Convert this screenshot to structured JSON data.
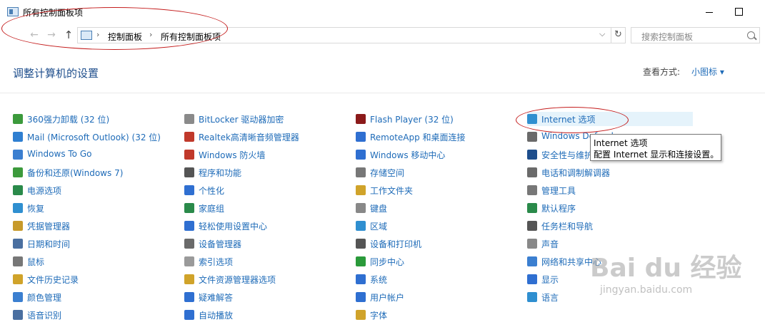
{
  "window": {
    "title": "所有控制面板项"
  },
  "nav": {
    "back": "←",
    "forward": "→",
    "up": "↑"
  },
  "address": {
    "crumbs": [
      "控制面板",
      "所有控制面板项"
    ],
    "sep": "›",
    "dropdown": "⌵",
    "refresh": "↻"
  },
  "search": {
    "placeholder": "搜索控制面板"
  },
  "heading": "调整计算机的设置",
  "view": {
    "label": "查看方式:",
    "value": "小图标 ▾"
  },
  "columns": [
    [
      "360强力卸载 (32 位)",
      "Mail (Microsoft Outlook) (32 位)",
      "Windows To Go",
      "备份和还原(Windows 7)",
      "电源选项",
      "恢复",
      "凭据管理器",
      "日期和时间",
      "鼠标",
      "文件历史记录",
      "颜色管理",
      "语音识别"
    ],
    [
      "BitLocker 驱动器加密",
      "Realtek高清晰音频管理器",
      "Windows 防火墙",
      "程序和功能",
      "个性化",
      "家庭组",
      "轻松使用设置中心",
      "设备管理器",
      "索引选项",
      "文件资源管理器选项",
      "疑难解答",
      "自动播放"
    ],
    [
      "Flash Player (32 位)",
      "RemoteApp 和桌面连接",
      "Windows 移动中心",
      "存储空间",
      "工作文件夹",
      "键盘",
      "区域",
      "设备和打印机",
      "同步中心",
      "系统",
      "用户帐户",
      "字体"
    ],
    [
      "Internet 选项",
      "Windows Defender",
      "安全性与维护",
      "电话和调制解调器",
      "管理工具",
      "默认程序",
      "任务栏和导航",
      "声音",
      "网络和共享中心",
      "显示",
      "语言"
    ]
  ],
  "icon_colors": [
    [
      "#3c9a3c",
      "#2f7fd1",
      "#3b7fd0",
      "#3c9a3c",
      "#2a8a4a",
      "#2f8fd0",
      "#c79a2a",
      "#4a6fa0",
      "#777777",
      "#d0a32a",
      "#3b7fd0",
      "#4a6fa0"
    ],
    [
      "#8a8a8a",
      "#c0392b",
      "#c0392b",
      "#555555",
      "#2f6fd1",
      "#2a8a4a",
      "#2f6fd1",
      "#6a6a6a",
      "#9a9a9a",
      "#d0a32a",
      "#2f6fd1",
      "#2f6fd1"
    ],
    [
      "#8b1a1a",
      "#2f6fd1",
      "#2f6fd1",
      "#777777",
      "#d0a32a",
      "#888888",
      "#2f8fd0",
      "#555555",
      "#2a9a3a",
      "#2f6fd1",
      "#2f6fd1",
      "#d0a32a"
    ],
    [
      "#2f8fd0",
      "#6a6a6a",
      "#1e4e8c",
      "#6a6a6a",
      "#777777",
      "#2a8a4a",
      "#555555",
      "#888888",
      "#3b7fd0",
      "#2f6fd1",
      "#2f8fd0"
    ]
  ],
  "tooltip": {
    "line1": "Internet 选项",
    "line2": "配置 Internet 显示和连接设置。"
  },
  "watermark": {
    "logo": "Bai du 经验",
    "url": "jingyan.baidu.com"
  }
}
